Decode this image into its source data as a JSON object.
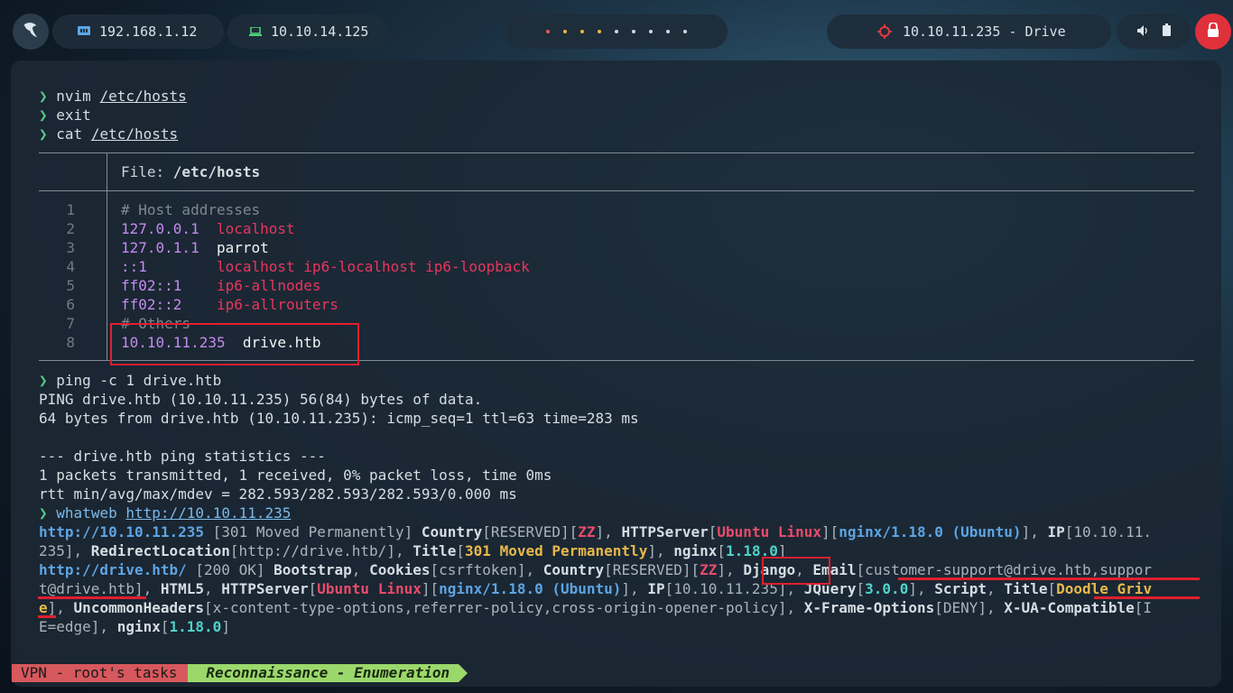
{
  "topbar": {
    "local_ip": "192.168.1.12",
    "vpn_ip": "10.10.14.125",
    "target": "10.10.11.235 - Drive",
    "workspace_colors": [
      "#e05a5a",
      "#e8b948",
      "#e8b948",
      "#e8b948",
      "#cfd8de",
      "#cfd8de",
      "#cfd8de",
      "#cfd8de",
      "#cfd8de"
    ]
  },
  "terminal": {
    "prompt_symbol": "❯",
    "cmd1": "nvim",
    "cmd1_arg": "/etc/hosts",
    "cmd2": "exit",
    "cmd3": "cat",
    "cmd3_arg": "/etc/hosts",
    "file_label": "File: ",
    "file_name": "/etc/hosts",
    "hosts": [
      {
        "n": "1",
        "ip": "# Host addresses",
        "name": "",
        "type": "comment"
      },
      {
        "n": "2",
        "ip": "127.0.0.1",
        "name": "localhost",
        "type": "red"
      },
      {
        "n": "3",
        "ip": "127.0.1.1",
        "name": "parrot",
        "type": "plain"
      },
      {
        "n": "4",
        "ip": "::1",
        "name": "localhost ip6-localhost ip6-loopback",
        "type": "red"
      },
      {
        "n": "5",
        "ip": "ff02::1",
        "name": "ip6-allnodes",
        "type": "red"
      },
      {
        "n": "6",
        "ip": "ff02::2",
        "name": "ip6-allrouters",
        "type": "red"
      },
      {
        "n": "7",
        "ip": "# Others",
        "name": "",
        "type": "comment"
      },
      {
        "n": "8",
        "ip": "10.10.11.235",
        "name": "drive.htb",
        "type": "plain"
      }
    ],
    "ping_cmd": "ping -c 1 drive.htb",
    "ping_l1": "PING drive.htb (10.10.11.235) 56(84) bytes of data.",
    "ping_l2": "64 bytes from drive.htb (10.10.11.235): icmp_seq=1 ttl=63 time=283 ms",
    "ping_l3": "--- drive.htb ping statistics ---",
    "ping_l4": "1 packets transmitted, 1 received, 0% packet loss, time 0ms",
    "ping_l5": "rtt min/avg/max/mdev = 282.593/282.593/282.593/0.000 ms",
    "whatweb_cmd": "whatweb",
    "whatweb_arg": "http://10.10.11.235",
    "ww": {
      "l1_url": "http://10.10.11.235",
      "l1_status": " [301 Moved Permanently] ",
      "country": "Country",
      "reserved": "[RESERVED][",
      "zz": "ZZ",
      "httpserver": "HTTPServer",
      "ubuntu_linux": "Ubuntu Linux",
      "nginx_ver": "nginx/1.18.0 (Ubuntu)",
      "ip": "IP",
      "l1_ip_tail": "[10.10.11.",
      "l2_ip_rest": "235], ",
      "redirect": "RedirectLocation",
      "redirect_val": "[http://drive.htb/], ",
      "title": "Title",
      "title_301": "301 Moved Permanently",
      "nginx": "nginx",
      "nginx_short": "1.18.0",
      "l3_url": "http://drive.htb/",
      "l3_status": " [200 OK] ",
      "bootstrap": "Bootstrap",
      "cookies": "Cookies",
      "cookies_val": "[csrftoken], ",
      "django": "Django",
      "email": "Email",
      "email_val1": "[customer-support@drive.htb,suppor",
      "email_val2": "t@drive.htb]",
      "html5": "HTML5",
      "ip_val": "[10.10.11.235], ",
      "jquery": "JQuery",
      "jquery_ver": "3.0.0",
      "script": "Script",
      "title_val1": "Doodle Griv",
      "title_val2": "e",
      "uncommon": "UncommonHeaders",
      "uncommon_val": "[x-content-type-options,referrer-policy,cross-origin-opener-policy], ",
      "xframe": "X-Frame-Options",
      "xframe_val": "[DENY], ",
      "xua": "X-UA-Compatible",
      "xua_val1": "[I",
      "xua_val2": "E=edge], "
    }
  },
  "statusbar": {
    "session": "VPN - root's tasks",
    "window": "Reconnaissance - Enumeration"
  }
}
